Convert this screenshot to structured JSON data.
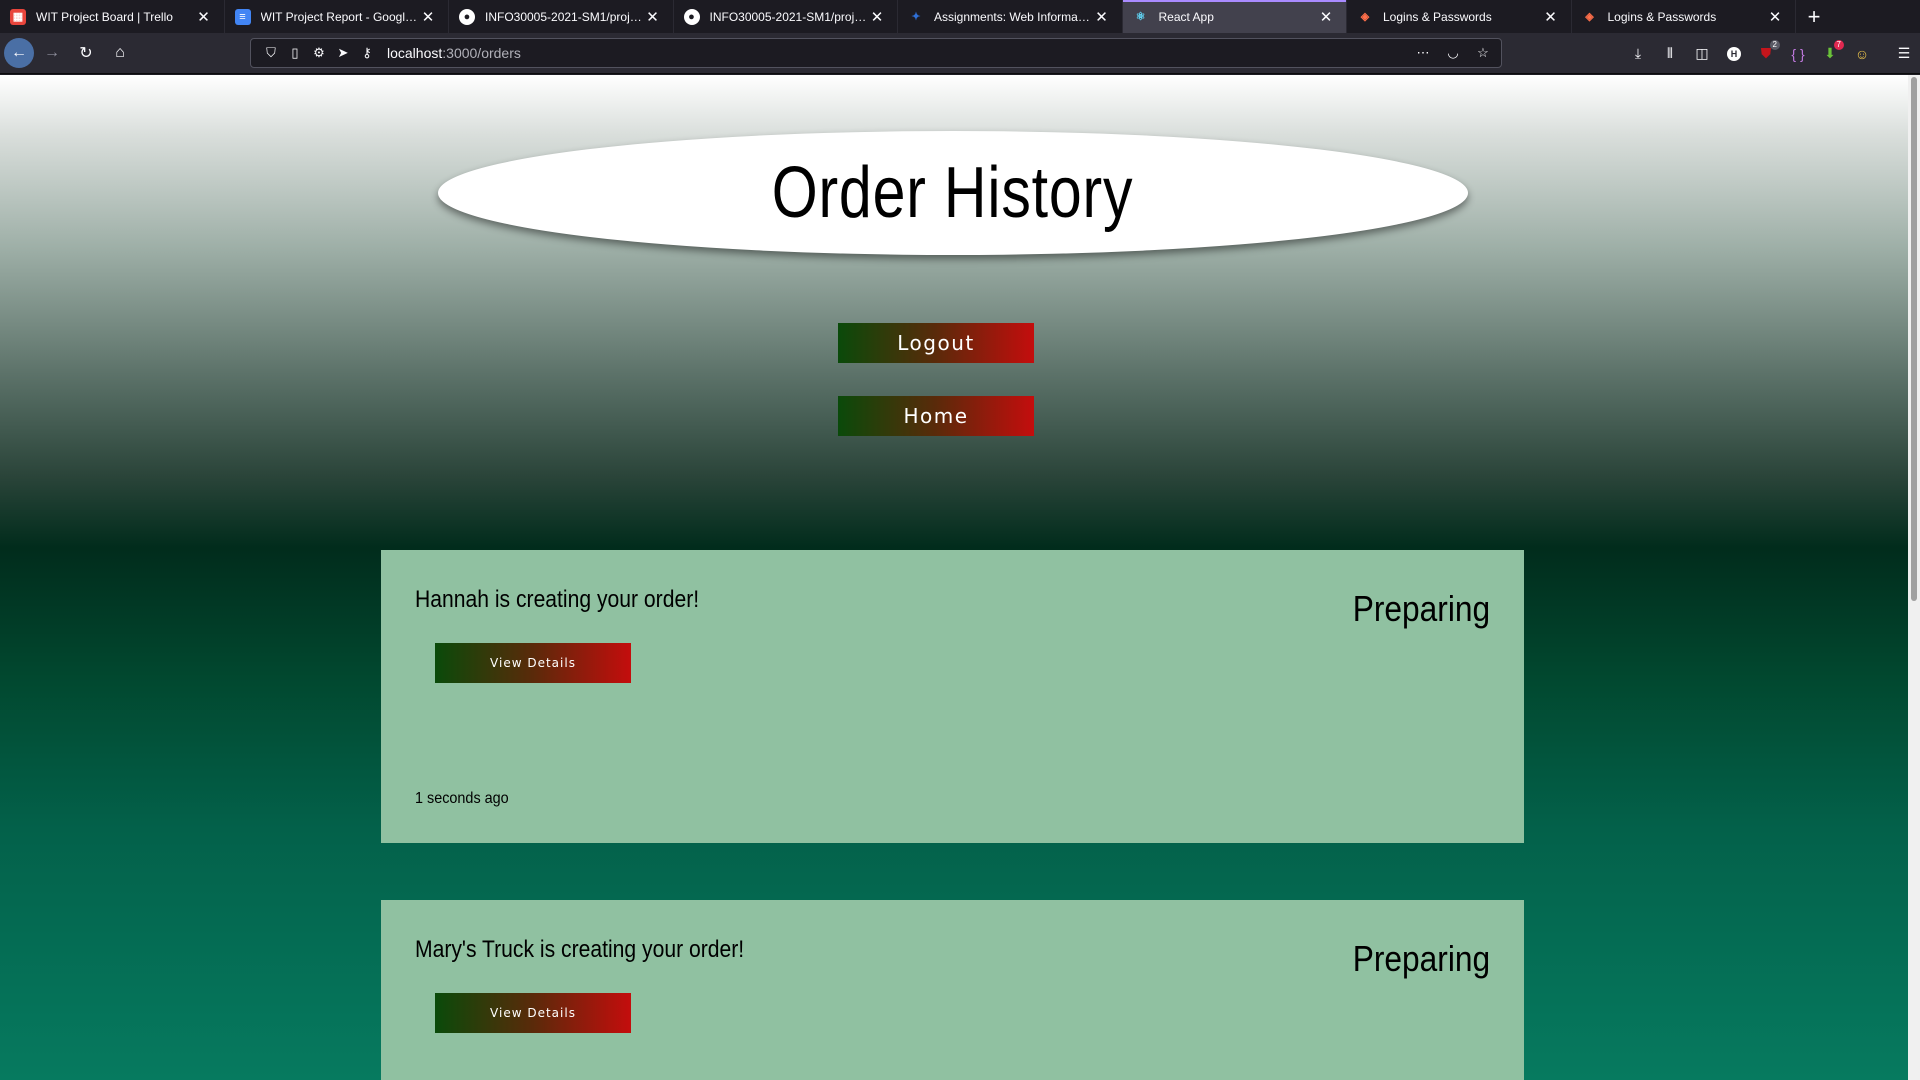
{
  "browser": {
    "tabs": [
      {
        "title": "WIT Project Board | Trello",
        "icon": "trello-icon",
        "color": "#e8453c"
      },
      {
        "title": "WIT Project Report - Google Do",
        "icon": "google-docs-icon",
        "color": "#4285f4"
      },
      {
        "title": "INFO30005-2021-SM1/project",
        "icon": "github-icon",
        "color": "#ffffff"
      },
      {
        "title": "INFO30005-2021-SM1/project",
        "icon": "github-icon",
        "color": "#ffffff"
      },
      {
        "title": "Assignments: Web Information",
        "icon": "canvas-icon",
        "color": "#2f6fd6"
      },
      {
        "title": "React App",
        "icon": "react-icon",
        "color": "#61dafb",
        "active": true
      },
      {
        "title": "Logins & Passwords",
        "icon": "lockwise-icon",
        "color": "#ff6f4a"
      },
      {
        "title": "Logins & Passwords",
        "icon": "lockwise-icon",
        "color": "#ff6f4a"
      }
    ],
    "url_host": "localhost",
    "url_path": ":3000/orders",
    "badges": {
      "ublock": "2",
      "extension": "7"
    }
  },
  "page": {
    "title": "Order History",
    "logout_label": "Logout",
    "home_label": "Home"
  },
  "orders": [
    {
      "message": "Hannah is creating your order!",
      "status": "Preparing",
      "button": "View Details",
      "time": "1 seconds ago"
    },
    {
      "message": "Mary's Truck is creating your order!",
      "status": "Preparing",
      "button": "View Details"
    }
  ]
}
